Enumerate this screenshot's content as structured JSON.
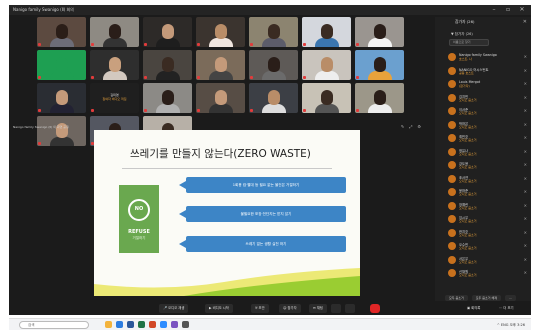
{
  "window": {
    "title": "Nanigo family Swanigo (Ⅱ) 회의",
    "controls": [
      "minimize",
      "maximize",
      "close"
    ]
  },
  "gallery": {
    "tiles": [
      {
        "name": "",
        "bg": "#5c4a40",
        "skin": "#2b1e18",
        "shirt": "#6d6d78"
      },
      {
        "name": "",
        "bg": "#8e8a83",
        "skin": "#2a1e19",
        "shirt": "#333"
      },
      {
        "name": "",
        "bg": "#2d2a28",
        "skin": "#c49a7a",
        "shirt": "#1e1e1e"
      },
      {
        "name": "",
        "bg": "#3b342f",
        "skin": "#b98d68",
        "shirt": "#f0e6e0"
      },
      {
        "name": "",
        "bg": "#8c8470",
        "skin": "#3a2b22",
        "shirt": "#5c5c6a"
      },
      {
        "name": "",
        "bg": "#d4d7dd",
        "skin": "#3a2b22",
        "shirt": "#3b76b0"
      },
      {
        "name": "",
        "bg": "#9a9590",
        "skin": "#2a1e19",
        "shirt": "#f4f4f4"
      },
      {
        "name": "",
        "bg": "#1e9f52",
        "skin": "#1e9f52",
        "shirt": "#1e9f52"
      },
      {
        "name": "",
        "bg": "#2e2e2e",
        "skin": "#c9a07e",
        "shirt": "#d3c9c0"
      },
      {
        "name": "",
        "bg": "#4a4540",
        "skin": "#3a2b22",
        "shirt": "#222"
      },
      {
        "name": "",
        "bg": "#7b6b5a",
        "skin": "#c49a7a",
        "shirt": "#444"
      },
      {
        "name": "",
        "bg": "#5e5a57",
        "skin": "#2a1e19",
        "shirt": "#6b6b6b"
      },
      {
        "name": "",
        "bg": "#c9c4bd",
        "skin": "#b98d68",
        "shirt": "#eee"
      },
      {
        "name": "",
        "bg": "#6ba0cf",
        "skin": "#2a1e19",
        "shirt": "#e8a23b"
      },
      {
        "name": "",
        "bg": "#2a2d33",
        "skin": "#c49a7a",
        "shirt": "#223"
      },
      {
        "name": "",
        "bg": "#1f1f1f",
        "skin": "#1f1f1f",
        "shirt": "#1f1f1f",
        "label": "김미영",
        "label2": "참여자 비디오 꺼짐"
      },
      {
        "name": "",
        "bg": "#8c8a86",
        "skin": "#2a1e19",
        "shirt": "#b0b0b0"
      },
      {
        "name": "",
        "bg": "#574d45",
        "skin": "#c49a7a",
        "shirt": "#333"
      },
      {
        "name": "",
        "bg": "#3c3f45",
        "skin": "#b98d68",
        "shirt": "#ddd"
      },
      {
        "name": "",
        "bg": "#c8c2b6",
        "skin": "#3a2b22",
        "shirt": "#555"
      },
      {
        "name": "",
        "bg": "#9c9789",
        "skin": "#2a1e19",
        "shirt": "#eee"
      },
      {
        "name": "",
        "bg": "#6e6660",
        "skin": "#c49a7a",
        "shirt": "#333"
      },
      {
        "name": "",
        "bg": "#545761",
        "skin": "#2a1e19",
        "shirt": "#888"
      },
      {
        "name": "",
        "bg": "#b7b0a7",
        "skin": "#3a2b22",
        "shirt": "#f0f0f0"
      }
    ]
  },
  "screenshare": {
    "label": "Nanigo family Swanigo (Ⅱ) 의 화면 공유",
    "tools": [
      "✎",
      "⤢",
      "⚙"
    ]
  },
  "slide": {
    "title": "쓰레기를 만들지 않는다(ZERO WASTE)",
    "card": {
      "circle_text": "NO",
      "main": "REFUSE",
      "sub": "거절하기"
    },
    "pills": [
      "1회용 컵·빨대 등 필요 없는 물건은 거절하기",
      "불필요한 포장·전단지는 받지 않기",
      "쓰레기 없는 생활 실천 하기"
    ],
    "colors": {
      "card": "#6aa84f",
      "pill": "#3d85c6",
      "wave_green": "#9acd32",
      "wave_yellow": "#ece976"
    }
  },
  "panel": {
    "title": "참가자 (26)",
    "section": "▼ 참가자 (26)",
    "search_placeholder": "이름으로 찾기",
    "participants": [
      {
        "name": "Nanigo family Swanigo",
        "status": "호스트, 나"
      },
      {
        "name": "NANIGO 어시스턴트",
        "status": "공동 호스트"
      },
      {
        "name": "Louis Mergot",
        "status": "(참가자)"
      },
      {
        "name": "김지민",
        "status": "오디오 음소거"
      },
      {
        "name": "이서준",
        "status": "오디오 음소거"
      },
      {
        "name": "박하은",
        "status": "오디오 음소거"
      },
      {
        "name": "최민호",
        "status": "오디오 음소거"
      },
      {
        "name": "정유나",
        "status": "오디오 음소거"
      },
      {
        "name": "강도윤",
        "status": "오디오 음소거"
      },
      {
        "name": "조서연",
        "status": "오디오 음소거"
      },
      {
        "name": "윤하준",
        "status": "오디오 음소거"
      },
      {
        "name": "장예린",
        "status": "오디오 음소거"
      },
      {
        "name": "임시우",
        "status": "오디오 음소거"
      },
      {
        "name": "한지호",
        "status": "오디오 음소거"
      },
      {
        "name": "오수빈",
        "status": "오디오 음소거"
      },
      {
        "name": "서은우",
        "status": "오디오 음소거"
      },
      {
        "name": "신채원",
        "status": "오디오 음소거"
      }
    ],
    "footer": [
      "모두 음소거",
      "모두 음소거 해제",
      "..."
    ]
  },
  "toolbar": {
    "left": [
      "오디오 재생",
      "비디오 시작",
      "보안",
      "참가자",
      "채팅",
      "화면 공유",
      "기록"
    ],
    "right": [
      "회의록",
      "더 보기"
    ],
    "end_color": "#e02626"
  },
  "taskbar": {
    "search": "검색",
    "tray": "^ ENG  오후 3:26"
  }
}
